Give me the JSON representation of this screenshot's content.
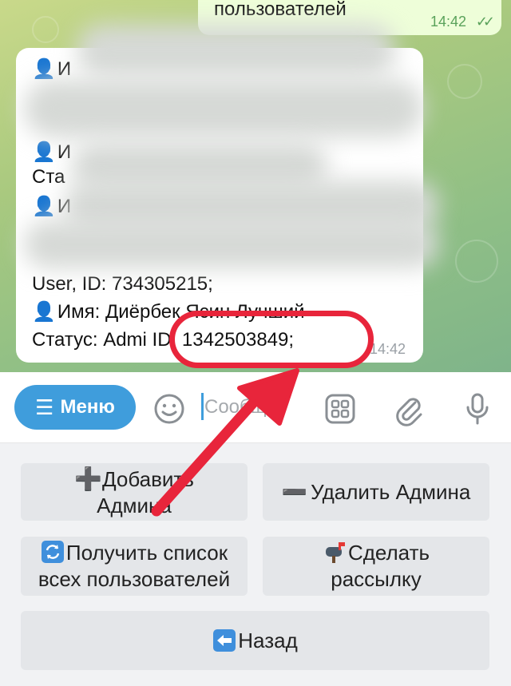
{
  "chat": {
    "outgoing": {
      "text": "пользователей",
      "time": "14:42"
    },
    "incoming": {
      "lines": [
        "И",
        "И",
        "Ста",
        "И",
        "User, ID: 734305215;",
        "Имя: Диёрбек Ясин Лучший",
        "Статус: Admi  ID: 1342503849;"
      ],
      "time": "14:42",
      "highlight": "ID: 1342503849;"
    }
  },
  "inputbar": {
    "menu_label": "Меню",
    "placeholder": "Сообщ..."
  },
  "keyboard": {
    "add_admin": {
      "line1": "Добавить",
      "line2": "Админа"
    },
    "remove_admin": "Удалить Админа",
    "get_users": {
      "line1": "Получить список",
      "line2": "всех пользователей"
    },
    "broadcast": {
      "line1": "Сделать",
      "line2": "рассылку"
    },
    "back": "Назад"
  }
}
